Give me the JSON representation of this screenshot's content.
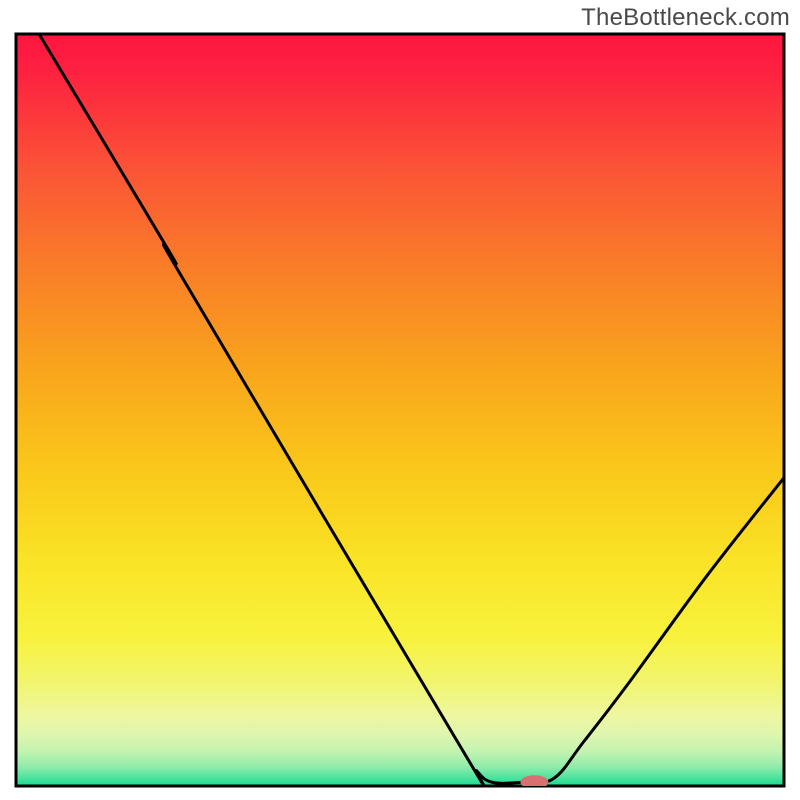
{
  "watermark": "TheBottleneck.com",
  "chart_data": {
    "type": "line",
    "title": "",
    "xlabel": "",
    "ylabel": "",
    "xlim": [
      0,
      100
    ],
    "ylim": [
      0,
      100
    ],
    "grid": false,
    "curve_points": [
      {
        "x": 3,
        "y": 100
      },
      {
        "x": 20,
        "y": 71
      },
      {
        "x": 22,
        "y": 67
      },
      {
        "x": 58,
        "y": 5
      },
      {
        "x": 60,
        "y": 2
      },
      {
        "x": 62,
        "y": 0.5
      },
      {
        "x": 66,
        "y": 0.5
      },
      {
        "x": 70,
        "y": 1
      },
      {
        "x": 74,
        "y": 6
      },
      {
        "x": 80,
        "y": 14
      },
      {
        "x": 90,
        "y": 28
      },
      {
        "x": 100,
        "y": 41
      }
    ],
    "marker": {
      "x": 67.5,
      "y": 0.5,
      "color": "#d86f72",
      "rx": 14,
      "ry": 7
    },
    "gradient_stops": [
      {
        "offset": 0.0,
        "color": "#fd1640"
      },
      {
        "offset": 0.05,
        "color": "#fd2140"
      },
      {
        "offset": 0.18,
        "color": "#fb5436"
      },
      {
        "offset": 0.32,
        "color": "#f98027"
      },
      {
        "offset": 0.45,
        "color": "#f9a61c"
      },
      {
        "offset": 0.58,
        "color": "#fac81a"
      },
      {
        "offset": 0.7,
        "color": "#fae326"
      },
      {
        "offset": 0.8,
        "color": "#f8f23c"
      },
      {
        "offset": 0.86,
        "color": "#f2f56c"
      },
      {
        "offset": 0.905,
        "color": "#eef79e"
      },
      {
        "offset": 0.93,
        "color": "#e0f6ae"
      },
      {
        "offset": 0.955,
        "color": "#c1f3b0"
      },
      {
        "offset": 0.975,
        "color": "#8eebaa"
      },
      {
        "offset": 0.99,
        "color": "#48e29d"
      },
      {
        "offset": 1.0,
        "color": "#14dc8e"
      }
    ],
    "frame": {
      "stroke": "#000000",
      "stroke_width": 3
    },
    "line_style": {
      "stroke": "#000000",
      "stroke_width": 3
    }
  }
}
